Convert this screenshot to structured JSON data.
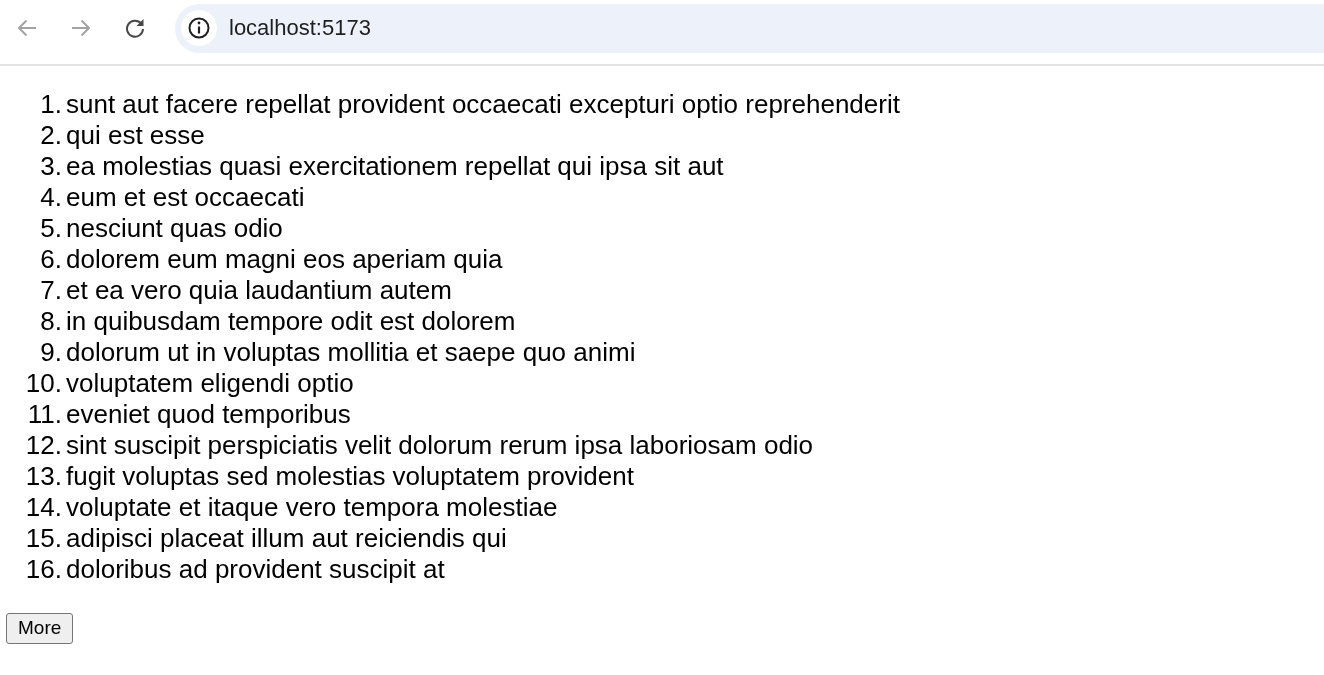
{
  "browser": {
    "nav_buttons": [
      {
        "kind": "back",
        "disabled": true
      },
      {
        "kind": "forward",
        "disabled": true
      },
      {
        "kind": "reload",
        "disabled": false
      }
    ],
    "address": "localhost:5173"
  },
  "list": {
    "items": [
      {
        "number": "1.",
        "text": "sunt aut facere repellat provident occaecati excepturi optio reprehenderit"
      },
      {
        "number": "2.",
        "text": "qui est esse"
      },
      {
        "number": "3.",
        "text": "ea molestias quasi exercitationem repellat qui ipsa sit aut"
      },
      {
        "number": "4.",
        "text": "eum et est occaecati"
      },
      {
        "number": "5.",
        "text": "nesciunt quas odio"
      },
      {
        "number": "6.",
        "text": "dolorem eum magni eos aperiam quia"
      },
      {
        "number": "7.",
        "text": "et ea vero quia laudantium autem"
      },
      {
        "number": "8.",
        "text": "in quibusdam tempore odit est dolorem"
      },
      {
        "number": "9.",
        "text": "dolorum ut in voluptas mollitia et saepe quo animi"
      },
      {
        "number": "10.",
        "text": "voluptatem eligendi optio"
      },
      {
        "number": "11.",
        "text": "eveniet quod temporibus"
      },
      {
        "number": "12.",
        "text": "sint suscipit perspiciatis velit dolorum rerum ipsa laboriosam odio"
      },
      {
        "number": "13.",
        "text": "fugit voluptas sed molestias voluptatem provident"
      },
      {
        "number": "14.",
        "text": "voluptate et itaque vero tempora molestiae"
      },
      {
        "number": "15.",
        "text": "adipisci placeat illum aut reiciendis qui"
      },
      {
        "number": "16.",
        "text": "doloribus ad provident suscipit at"
      }
    ]
  },
  "buttons": [
    {
      "label": "More"
    }
  ]
}
